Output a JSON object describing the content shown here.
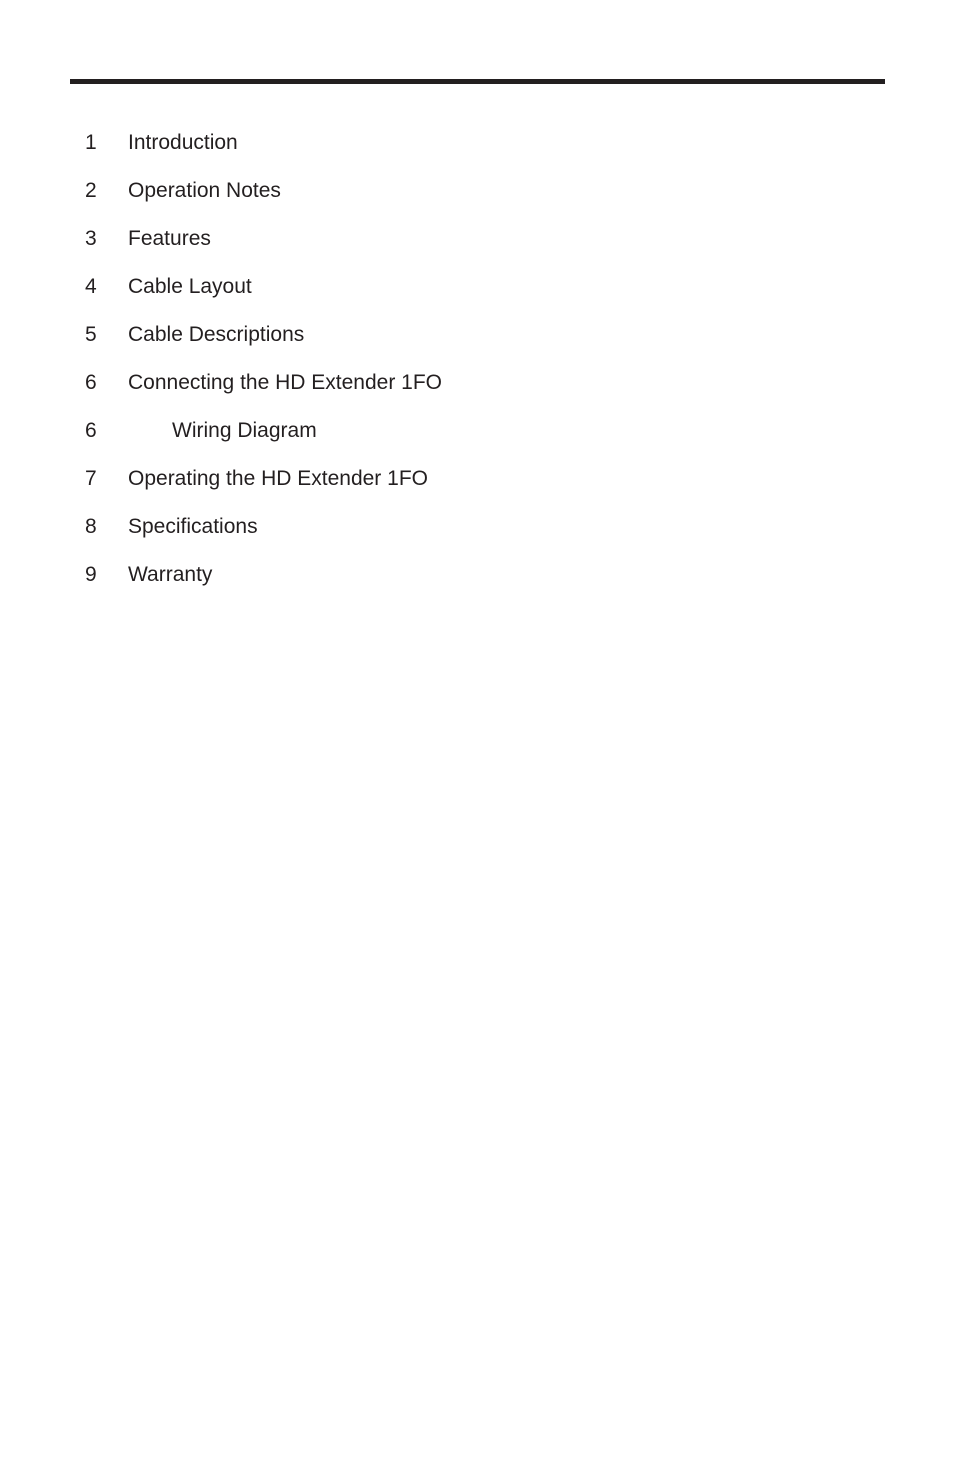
{
  "page": {
    "background_color": "#ffffff",
    "text_color": "#231f20"
  },
  "header": {
    "rule_color": "#231f20"
  },
  "toc": {
    "entries": [
      {
        "number": "1",
        "label": "Introduction",
        "level": 1
      },
      {
        "number": "2",
        "label": "Operation Notes",
        "level": 1
      },
      {
        "number": "3",
        "label": "Features",
        "level": 1
      },
      {
        "number": "4",
        "label": "Cable Layout",
        "level": 1
      },
      {
        "number": "5",
        "label": "Cable Descriptions",
        "level": 1
      },
      {
        "number": "6",
        "label": "Connecting the HD Extender 1FO",
        "level": 1
      },
      {
        "number": "6",
        "label": "Wiring Diagram",
        "level": 2
      },
      {
        "number": "7",
        "label": "Operating the HD Extender 1FO",
        "level": 1
      },
      {
        "number": "8",
        "label": "Specifications",
        "level": 1
      },
      {
        "number": "9",
        "label": "Warranty",
        "level": 1
      }
    ]
  }
}
